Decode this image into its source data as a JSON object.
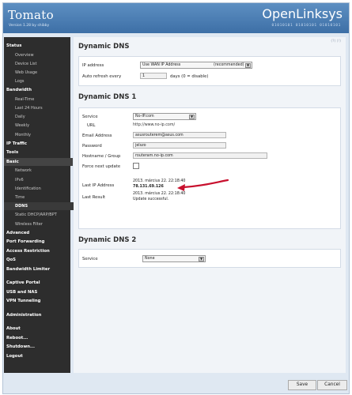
{
  "header": {
    "app_name": "Tomato",
    "version": "Version 1.28 by shibby",
    "right_title": "OpenLinksys",
    "right_subtitle": "01010101 01010101 01010101"
  },
  "sidebar": {
    "items": [
      {
        "label": "Status",
        "kind": "section"
      },
      {
        "label": "Overview",
        "kind": "sub"
      },
      {
        "label": "Device List",
        "kind": "sub"
      },
      {
        "label": "Web Usage",
        "kind": "sub"
      },
      {
        "label": "Logs",
        "kind": "sub"
      },
      {
        "label": "Bandwidth",
        "kind": "section"
      },
      {
        "label": "Real-Time",
        "kind": "sub"
      },
      {
        "label": "Last 24 Hours",
        "kind": "sub"
      },
      {
        "label": "Daily",
        "kind": "sub"
      },
      {
        "label": "Weekly",
        "kind": "sub"
      },
      {
        "label": "Monthly",
        "kind": "sub"
      },
      {
        "label": "IP Traffic",
        "kind": "section"
      },
      {
        "label": "Tools",
        "kind": "section"
      },
      {
        "label": "Basic",
        "kind": "section"
      },
      {
        "label": "Network",
        "kind": "sub"
      },
      {
        "label": "IPv6",
        "kind": "sub"
      },
      {
        "label": "Identification",
        "kind": "sub"
      },
      {
        "label": "Time",
        "kind": "sub"
      },
      {
        "label": "DDNS",
        "kind": "sub"
      },
      {
        "label": "Static DHCP/ARP/BPT",
        "kind": "sub"
      },
      {
        "label": "Wireless Filter",
        "kind": "sub"
      },
      {
        "label": "Advanced",
        "kind": "section"
      },
      {
        "label": "Port Forwarding",
        "kind": "section"
      },
      {
        "label": "Access Restriction",
        "kind": "section"
      },
      {
        "label": "QoS",
        "kind": "section"
      },
      {
        "label": "Bandwidth Limiter",
        "kind": "section"
      },
      {
        "label": "Captive Portal",
        "kind": "section"
      },
      {
        "label": "USB and NAS",
        "kind": "section"
      },
      {
        "label": "VPN Tunneling",
        "kind": "section"
      },
      {
        "label": "Administration",
        "kind": "section"
      },
      {
        "label": "About",
        "kind": "section"
      },
      {
        "label": "Reboot...",
        "kind": "section"
      },
      {
        "label": "Shutdown...",
        "kind": "section"
      },
      {
        "label": "Logout",
        "kind": "section"
      }
    ],
    "active_item": "DDNS"
  },
  "help_link": "(?) (!)",
  "ddns": {
    "title": "Dynamic DNS",
    "ip_address_label": "IP address",
    "ip_address_value": "Use WAN IP Address",
    "ip_address_hint": "(recommended)",
    "auto_refresh_label": "Auto refresh every",
    "auto_refresh_value": "1",
    "auto_refresh_suffix": "days (0 = disable)"
  },
  "ddns1": {
    "title": "Dynamic DNS 1",
    "service_label": "Service",
    "service_value": "No-IP.com",
    "url_label": "URL",
    "url_value": "http://www.no-ip.com/",
    "email_label": "Email Address",
    "email_value": "asusrouterem@asus.com",
    "password_label": "Password",
    "password_value": "jelszo",
    "hostname_label": "Hostname / Group",
    "hostname_value": "routeram.no-ip.com",
    "force_label": "Force next update",
    "last_ip_label": "Last IP Address",
    "last_ip_date": "2013. március 22. 22:18:40",
    "last_ip_value": "78.131.69.126",
    "last_result_label": "Last Result",
    "last_result_date": "2013. március 22. 22:18:40",
    "last_result_value": "Update successful."
  },
  "ddns2": {
    "title": "Dynamic DNS 2",
    "service_label": "Service",
    "service_value": "None"
  },
  "buttons": {
    "save": "Save",
    "cancel": "Cancel"
  },
  "colors": {
    "header_blue": "#4a7db5",
    "sidebar_bg": "#2d2d2d",
    "annotation_red": "#c8102e"
  }
}
